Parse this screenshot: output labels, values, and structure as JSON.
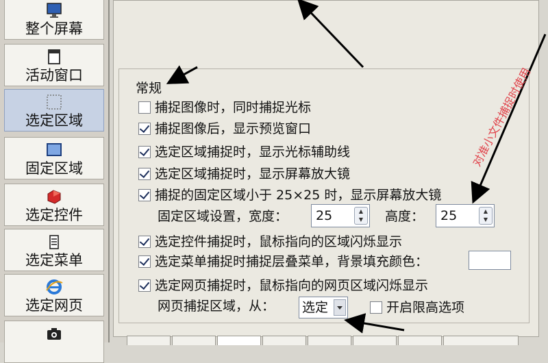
{
  "sidebar": {
    "items": [
      {
        "label": "整个屏幕",
        "icon": "monitor-icon"
      },
      {
        "label": "活动窗口",
        "icon": "window-icon"
      },
      {
        "label": "选定区域",
        "icon": "region-select-icon",
        "selected": true
      },
      {
        "label": "固定区域",
        "icon": "fixed-region-icon"
      },
      {
        "label": "选定控件",
        "icon": "control-icon"
      },
      {
        "label": "选定菜单",
        "icon": "menu-icon"
      },
      {
        "label": "选定网页",
        "icon": "ie-icon"
      }
    ]
  },
  "general": {
    "title": "常规",
    "options": [
      {
        "label": "捕捉图像时，同时捕捉光标",
        "checked": false
      },
      {
        "label": "捕捉图像后，显示预览窗口",
        "checked": true
      },
      {
        "label": "选定区域捕捉时，显示光标辅助线",
        "checked": true
      },
      {
        "label": "选定区域捕捉时，显示屏幕放大镜",
        "checked": true
      },
      {
        "label": "捕捉的固定区域小于 25×25 时，显示屏幕放大镜",
        "checked": true
      }
    ],
    "fixed_region": {
      "label": "固定区域设置，宽度：",
      "width_value": "25",
      "height_label": "高度：",
      "height_value": "25"
    },
    "options2": [
      {
        "label": "选定控件捕捉时，鼠标指向的区域闪烁显示",
        "checked": true
      },
      {
        "label": "选定菜单捕捉时捕捉层叠菜单，背景填充颜色：",
        "checked": true
      },
      {
        "label": "选定网页捕捉时，鼠标指向的网页区域闪烁显示",
        "checked": true
      }
    ],
    "web_region": {
      "label": "网页捕捉区域，从：",
      "select_value": "选定",
      "advanced_label": "开启限高选项",
      "advanced_checked": false
    }
  },
  "annotation": {
    "text": "对准小文件捕捉时使用",
    "color": "#e0434b"
  }
}
